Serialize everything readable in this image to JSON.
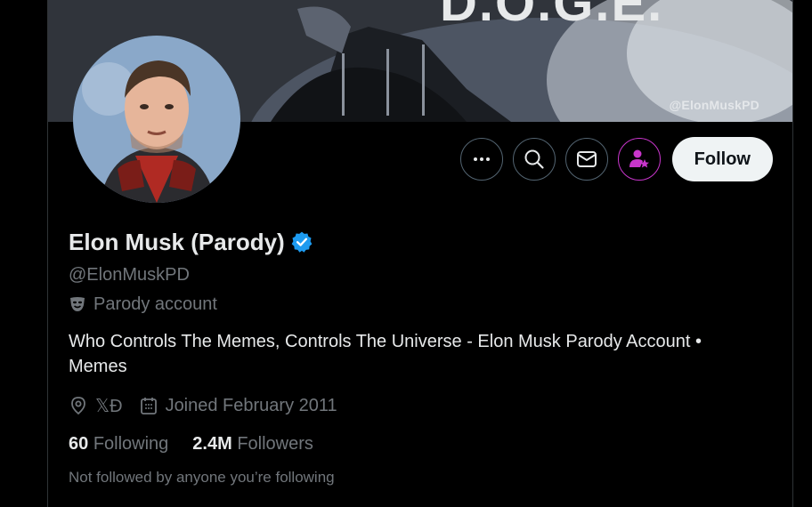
{
  "banner": {
    "watermark": "@ElonMuskPD",
    "headline": "D.O.G.E."
  },
  "actions": {
    "more_icon": "more-dots-icon",
    "search_icon": "search-icon",
    "message_icon": "mail-icon",
    "subscribe_icon": "person-star-icon",
    "follow_label": "Follow",
    "subscribe_color": "#c936cc"
  },
  "profile": {
    "name": "Elon Musk (Parody)",
    "verified_color": "#1d9bf0",
    "handle": "@ElonMuskPD",
    "parody_label": "Parody account",
    "bio": "Who Controls The Memes, Controls The Universe - Elon Musk Parody Account • Memes",
    "location": "𝕏Đ",
    "joined": "Joined February 2011",
    "following_count": "60",
    "following_label": "Following",
    "followers_count": "2.4M",
    "followers_label": "Followers",
    "not_followed": "Not followed by anyone you’re following"
  }
}
